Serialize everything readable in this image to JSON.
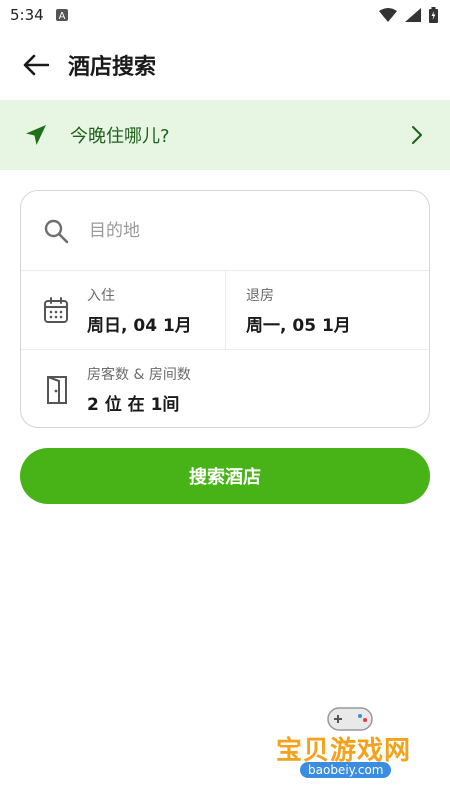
{
  "status_bar": {
    "time": "5:34",
    "notification_icon": "a-notification-icon",
    "icons": [
      "wifi-icon",
      "signal-icon",
      "battery-icon"
    ]
  },
  "header": {
    "title": "酒店搜索",
    "back_icon": "arrow-left-icon"
  },
  "location_banner": {
    "text": "今晚住哪儿?",
    "icon": "location-arrow-icon",
    "chevron": "chevron-right-icon"
  },
  "search": {
    "placeholder": "目的地",
    "value": ""
  },
  "checkin": {
    "label": "入住",
    "value": "周日, 04 1月"
  },
  "checkout": {
    "label": "退房",
    "value": "周一, 05 1月"
  },
  "guests": {
    "label": "房客数 & 房间数",
    "value": "2 位 在 1间"
  },
  "search_button": {
    "label": "搜索酒店"
  },
  "watermark": {
    "text": "宝贝游戏网",
    "url": "baobeiy.com"
  },
  "colors": {
    "accent": "#48b317",
    "banner_bg": "#e7f6e3",
    "banner_text": "#1f5f1c"
  }
}
